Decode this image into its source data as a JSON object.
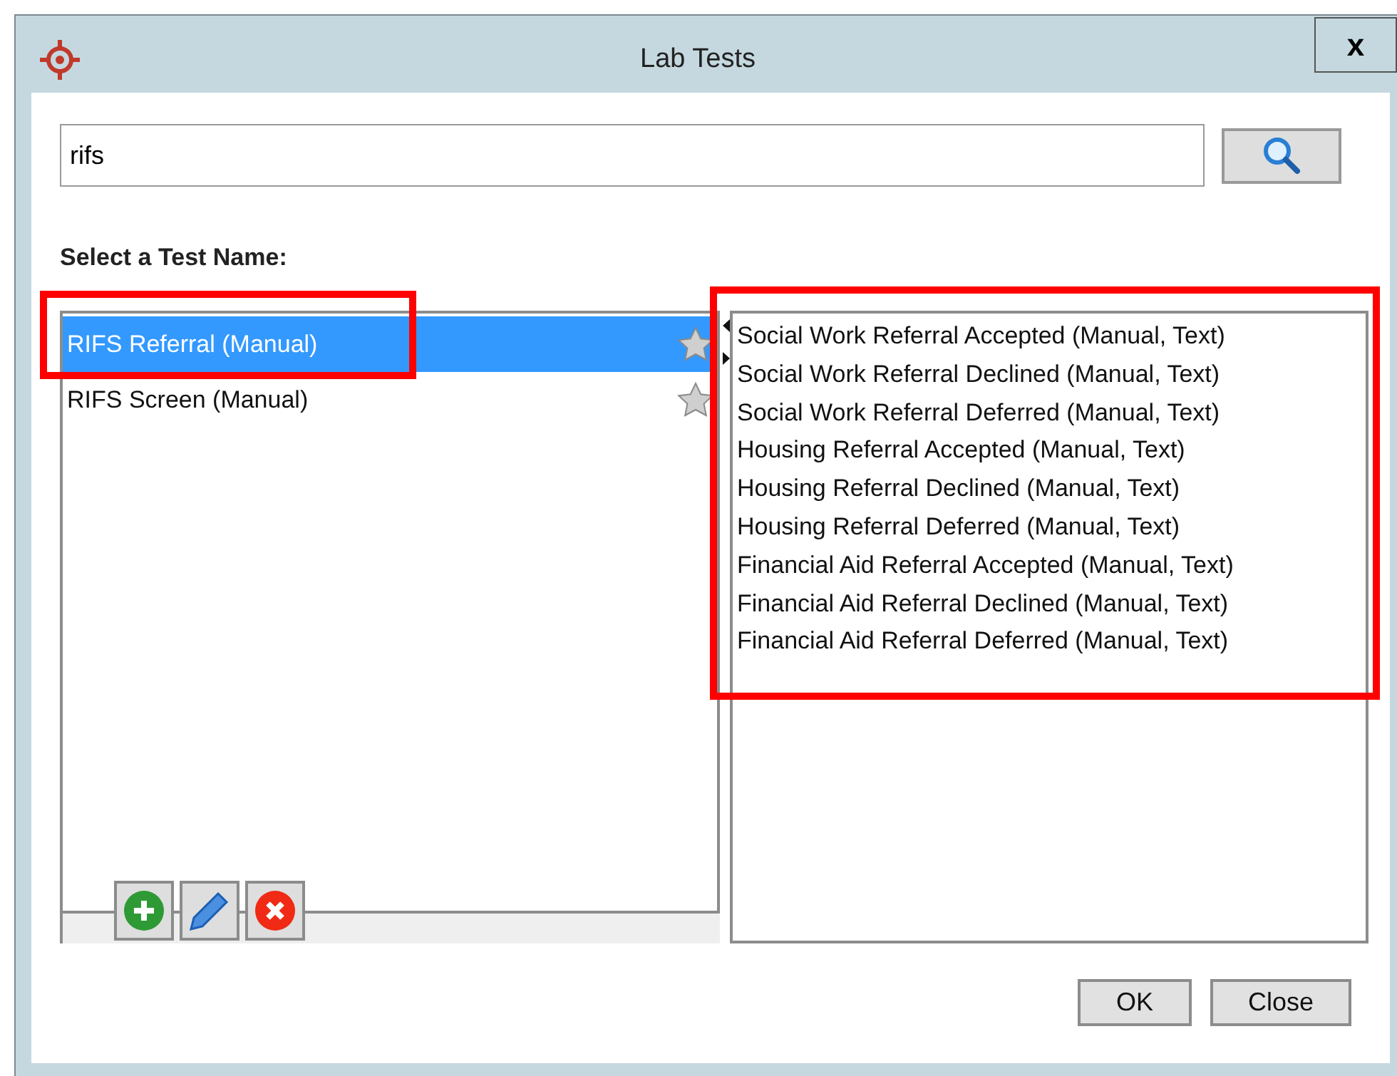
{
  "window": {
    "title": "Lab Tests",
    "close": "x"
  },
  "search": {
    "value": "rifs"
  },
  "list_label": "Select a Test Name:",
  "tests": [
    {
      "label": "RIFS Referral (Manual)",
      "selected": true,
      "highlighted": true
    },
    {
      "label": "RIFS Screen (Manual)",
      "selected": false,
      "highlighted": false
    }
  ],
  "results": {
    "highlighted": true,
    "items": [
      "Social Work Referral Accepted (Manual, Text)",
      "Social Work Referral Declined (Manual, Text)",
      "Social Work Referral Deferred (Manual, Text)",
      "Housing Referral Accepted (Manual, Text)",
      "Housing Referral Declined (Manual, Text)",
      "Housing Referral Deferred (Manual, Text)",
      "Financial Aid Referral Accepted (Manual, Text)",
      "Financial Aid Referral Declined (Manual, Text)",
      "Financial Aid Referral Deferred (Manual, Text)"
    ]
  },
  "toolbar": [
    {
      "kind": "add"
    },
    {
      "kind": "edit"
    },
    {
      "kind": "delete"
    }
  ],
  "buttons": [
    "OK",
    "Close"
  ]
}
